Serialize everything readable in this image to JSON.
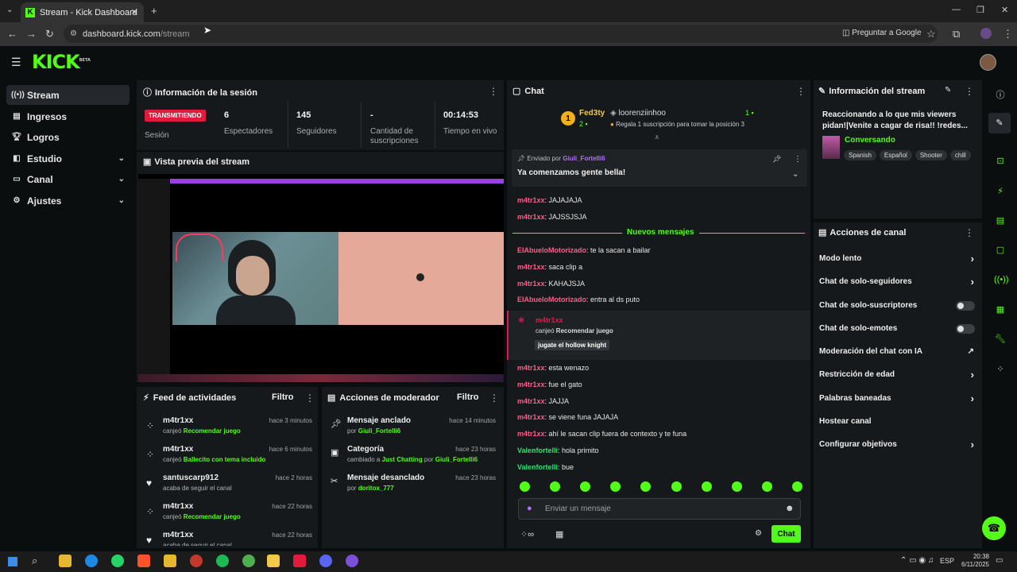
{
  "browser": {
    "tab_title": "Stream - Kick Dashboard",
    "url_host": "dashboard.kick.com",
    "url_path": "/stream",
    "ask_google": "Preguntar a Google"
  },
  "brand": {
    "logo": "KICK",
    "badge": "BETA"
  },
  "sidebar": {
    "items": [
      {
        "label": "Stream",
        "icon": "stream-icon"
      },
      {
        "label": "Ingresos",
        "icon": "revenue-icon"
      },
      {
        "label": "Logros",
        "icon": "trophy-icon"
      },
      {
        "label": "Estudio",
        "icon": "studio-icon"
      },
      {
        "label": "Canal",
        "icon": "channel-icon"
      },
      {
        "label": "Ajustes",
        "icon": "gear-icon"
      }
    ]
  },
  "session": {
    "title": "Información de la sesión",
    "status": "TRANSMITIENDO",
    "status_label": "Sesión",
    "stats": [
      {
        "value": "6",
        "label": "Espectadores"
      },
      {
        "value": "145",
        "label": "Seguidores"
      },
      {
        "value": "-",
        "label": "Cantidad de suscripciones"
      },
      {
        "value": "00:14:53",
        "label": "Tiempo en vivo"
      }
    ]
  },
  "preview": {
    "title": "Vista previa del stream"
  },
  "activity": {
    "title": "Feed de actividades",
    "filter": "Filtro",
    "items": [
      {
        "user": "m4tr1xx",
        "time": "hace 3 minutos",
        "pre": "canjeó ",
        "hl": "Recomendar juego",
        "icon": "redeem-icon"
      },
      {
        "user": "m4tr1xx",
        "time": "hace 6 minutos",
        "pre": "canjeó ",
        "hl": "Ballecito con tema incluido",
        "icon": "redeem-icon"
      },
      {
        "user": "santuscarp912",
        "time": "hace 2 horas",
        "pre": "acaba de seguir el canal",
        "hl": "",
        "icon": "heart-icon"
      },
      {
        "user": "m4tr1xx",
        "time": "hace 22 horas",
        "pre": "canjeó ",
        "hl": "Recomendar juego",
        "icon": "redeem-icon"
      },
      {
        "user": "m4tr1xx",
        "time": "hace 22 horas",
        "pre": "acaba de seguir el canal",
        "hl": "",
        "icon": "heart-icon"
      }
    ]
  },
  "mod": {
    "title": "Acciones de moderador",
    "filter": "Filtro",
    "items": [
      {
        "action": "Mensaje anclado",
        "time": "hace 14 minutos",
        "by": "por ",
        "user": "Giuli_Fortelli6"
      },
      {
        "action": "Categoría",
        "time": "hace 23 horas",
        "by": "cambiado a ",
        "cat": "Just Chatting",
        "by2": " por ",
        "user": "Giuli_Fortelli6"
      },
      {
        "action": "Mensaje desanclado",
        "time": "hace 23 horas",
        "by": "por ",
        "user": "doritox_777"
      }
    ]
  },
  "chat": {
    "title": "Chat",
    "leader": {
      "rank": "1",
      "name": "Fed3ty",
      "count": "2",
      "name2": "loorenziinhoo",
      "count2": "1",
      "note": "Regala 1 suscripción para tomar la posición 3"
    },
    "pinned": {
      "sent_by": "Enviado por",
      "user": "Giuli_Fortelli6",
      "text": "Ya comenzamos gente bella!"
    },
    "new_messages": "Nuevos mensajes",
    "messages": [
      {
        "user": "m4tr1xx",
        "text": "JAJAJAJA",
        "color": "pink"
      },
      {
        "user": "m4tr1xx",
        "text": "JAJSSJSJA",
        "color": "pink"
      },
      {
        "user": "ElAbueloMotorizado",
        "text": "te la sacan a bailar",
        "color": "pink"
      },
      {
        "user": "m4tr1xx",
        "text": "saca clip a",
        "color": "pink"
      },
      {
        "user": "m4tr1xx",
        "text": "KAHAJSJA",
        "color": "pink"
      },
      {
        "user": "ElAbueloMotorizado",
        "text": "entra al ds puto",
        "color": "pink"
      }
    ],
    "redeem": {
      "user": "m4tr1xx",
      "pre": "canjeó ",
      "reward": "Recomendar juego",
      "input": "jugate el hollow knight"
    },
    "messages2": [
      {
        "user": "m4tr1xx",
        "text": "esta wenazo",
        "color": "pink"
      },
      {
        "user": "m4tr1xx",
        "text": "fue el gato",
        "color": "pink"
      },
      {
        "user": "m4tr1xx",
        "text": "JAJJA",
        "color": "pink"
      },
      {
        "user": "m4tr1xx",
        "text": "se viene funa JAJAJA",
        "color": "pink"
      },
      {
        "user": "m4tr1xx",
        "text": "ahí le sacan clip fuera de contexto y te funa",
        "color": "pink"
      },
      {
        "user": "Valenfortelli",
        "text": "hola primito",
        "color": "green"
      },
      {
        "user": "Valenfortelli",
        "text": "bue",
        "color": "green"
      }
    ],
    "placeholder": "Enviar un mensaje",
    "send": "Chat"
  },
  "stream_info": {
    "title": "Información del stream",
    "stream_title": "Reaccionando a lo que mis viewers pidan!|Venite a cagar de risa!! !redes...",
    "category": "Conversando",
    "tags": [
      "Spanish",
      "Español",
      "Shooter",
      "chill"
    ]
  },
  "channel_actions": {
    "title": "Acciones de canal",
    "items": [
      {
        "label": "Modo lento",
        "control": "chevron"
      },
      {
        "label": "Chat de solo-seguidores",
        "control": "chevron"
      },
      {
        "label": "Chat de solo-suscriptores",
        "control": "toggle"
      },
      {
        "label": "Chat de solo-emotes",
        "control": "toggle"
      },
      {
        "label": "Moderación del chat con IA",
        "control": "external"
      },
      {
        "label": "Restricción de edad",
        "control": "chevron"
      },
      {
        "label": "Palabras baneadas",
        "control": "chevron"
      },
      {
        "label": "Hostear canal",
        "control": "none"
      },
      {
        "label": "Configurar objetivos",
        "control": "chevron"
      }
    ]
  },
  "taskbar": {
    "lang": "ESP",
    "time": "20:38",
    "date": "6/11/2025"
  }
}
